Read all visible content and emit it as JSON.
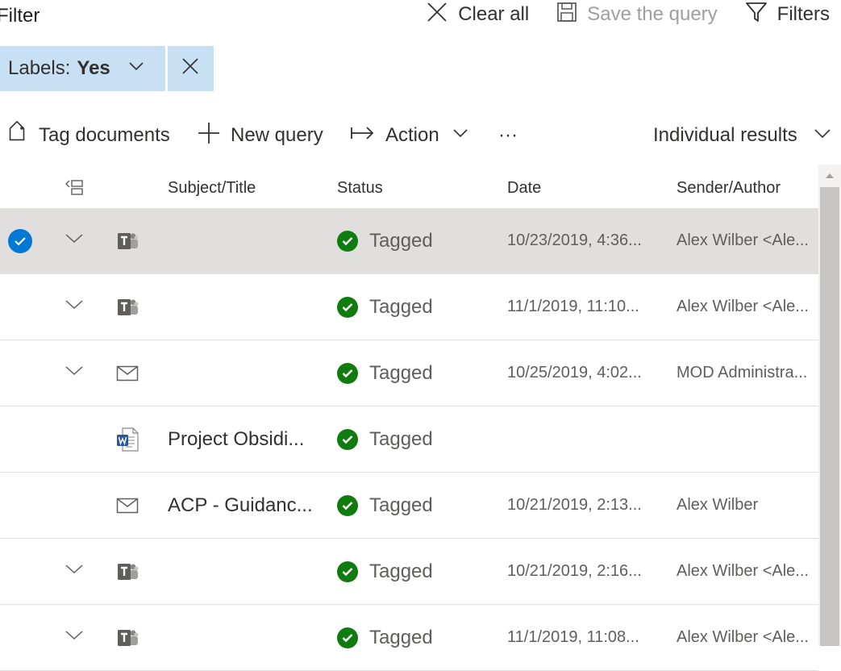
{
  "header": {
    "title": "Filter",
    "clear_all": "Clear all",
    "save_query": "Save the query",
    "filters": "Filters"
  },
  "filter_chip": {
    "label": "Labels:",
    "value": "Yes"
  },
  "toolbar": {
    "tag_documents": "Tag documents",
    "new_query": "New query",
    "action": "Action",
    "more": "···",
    "view": "Individual results"
  },
  "columns": {
    "subject": "Subject/Title",
    "status": "Status",
    "date": "Date",
    "sender": "Sender/Author"
  },
  "rows": [
    {
      "selected": true,
      "expandable": true,
      "icon": "teams-icon",
      "title": "",
      "status": "Tagged",
      "date": "10/23/2019, 4:36...",
      "sender": "Alex Wilber <Ale..."
    },
    {
      "selected": false,
      "expandable": true,
      "icon": "teams-icon",
      "title": "",
      "status": "Tagged",
      "date": "11/1/2019, 11:10...",
      "sender": "Alex Wilber <Ale..."
    },
    {
      "selected": false,
      "expandable": true,
      "icon": "mail-icon",
      "title": "",
      "status": "Tagged",
      "date": "10/25/2019, 4:02...",
      "sender": "MOD Administra..."
    },
    {
      "selected": false,
      "expandable": false,
      "icon": "word-icon",
      "title": "Project Obsidi...",
      "status": "Tagged",
      "date": "",
      "sender": ""
    },
    {
      "selected": false,
      "expandable": false,
      "icon": "mail-icon",
      "title": "ACP - Guidanc...",
      "status": "Tagged",
      "date": "10/21/2019, 2:13...",
      "sender": "Alex Wilber"
    },
    {
      "selected": false,
      "expandable": true,
      "icon": "teams-icon",
      "title": "",
      "status": "Tagged",
      "date": "10/21/2019, 2:16...",
      "sender": "Alex Wilber <Ale..."
    },
    {
      "selected": false,
      "expandable": true,
      "icon": "teams-icon",
      "title": "",
      "status": "Tagged",
      "date": "11/1/2019, 11:08...",
      "sender": "Alex Wilber <Ale..."
    }
  ],
  "colors": {
    "accent": "#0078d4",
    "chip": "#c7e0f4",
    "tagged": "#107c10",
    "selected_row": "#e1dfdd"
  }
}
